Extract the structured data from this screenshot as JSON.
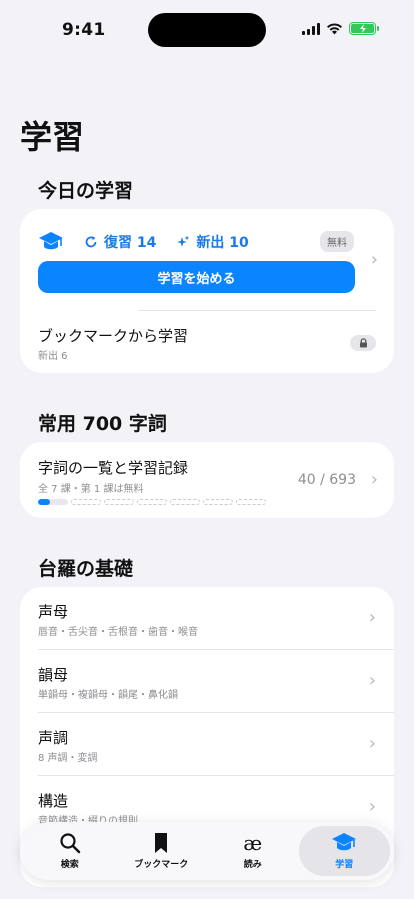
{
  "status": {
    "time": "9:41"
  },
  "page_title": "学習",
  "today": {
    "section_title": "今日の学習",
    "review_label": "復習 14",
    "new_label": "新出 10",
    "free_badge": "無料",
    "start_button": "学習を始める",
    "bookmark_title": "ブックマークから学習",
    "bookmark_sub": "新出 6"
  },
  "jouyou": {
    "section_title": "常用 700 字詞",
    "title": "字詞の一覧と学習記録",
    "subtitle": "全 7 課・第 1 課は無料",
    "count": "40 / 693",
    "progress_fraction": 0.058
  },
  "basics": {
    "section_title": "台羅の基礎",
    "rows": [
      {
        "title": "声母",
        "sub": "唇音・舌尖音・舌根音・歯音・喉音"
      },
      {
        "title": "韻母",
        "sub": "単韻母・複韻母・韻尾・鼻化韻"
      },
      {
        "title": "声調",
        "sub": "8 声調・変調"
      },
      {
        "title": "構造",
        "sub": "音節構造・綴りの規則"
      }
    ]
  },
  "tabbar": {
    "search": "検索",
    "bookmark": "ブックマーク",
    "read": "読み",
    "read_glyph": "æ",
    "study": "学習"
  },
  "colors": {
    "accent": "#0a84ff",
    "battery": "#34c759",
    "background": "#f2f2f7"
  }
}
